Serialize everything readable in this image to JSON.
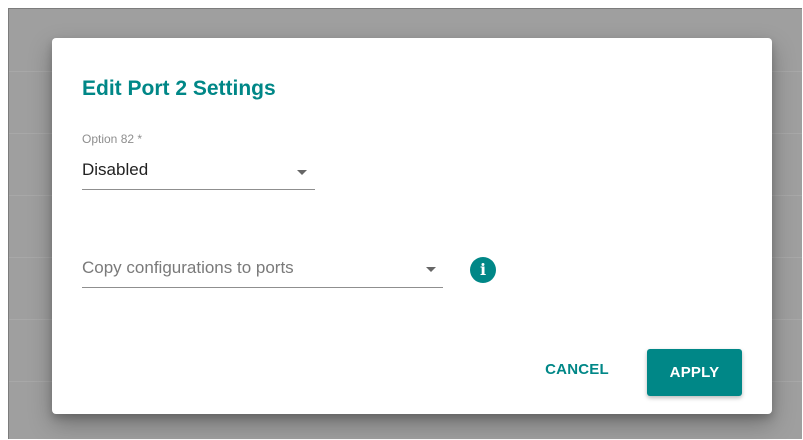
{
  "dialog": {
    "title": "Edit Port 2 Settings"
  },
  "option82": {
    "label": "Option 82 *",
    "value": "Disabled",
    "icon": "caret-down-icon"
  },
  "copy_ports": {
    "placeholder": "Copy configurations to ports",
    "icon": "caret-down-icon",
    "info_icon": "info-icon",
    "info_glyph": "i"
  },
  "actions": {
    "cancel_label": "CANCEL",
    "apply_label": "APPLY"
  },
  "colors": {
    "accent": "#008787",
    "backdrop": "#9f9f9f"
  }
}
